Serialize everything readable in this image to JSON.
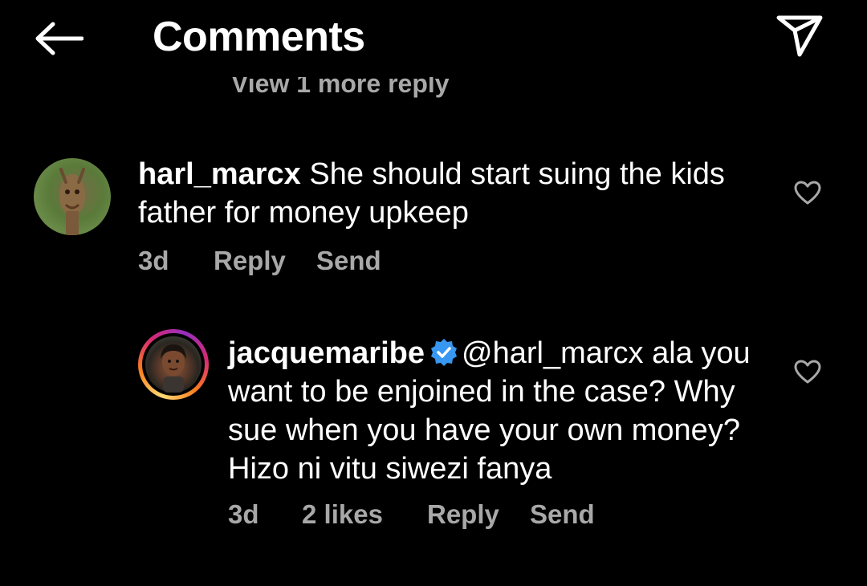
{
  "header": {
    "title": "Comments",
    "back_icon": "arrow-left-icon",
    "share_icon": "paper-plane-icon"
  },
  "view_more_replies": "View 1 more reply",
  "comments": [
    {
      "username": "harl_marcx",
      "text": "She should start suing the kids father for money upkeep",
      "time": "3d",
      "reply_label": "Reply",
      "send_label": "Send",
      "like_icon": "heart-outline-icon"
    },
    {
      "username": "jacquemaribe",
      "verified_icon": "verified-badge-icon",
      "mention": "@harl_marcx",
      "text": "ala you want to be enjoined in the case? Why sue when you have your own money? Hizo ni vitu siwezi fanya",
      "time": "3d",
      "likes": "2 likes",
      "reply_label": "Reply",
      "send_label": "Send",
      "like_icon": "heart-outline-icon"
    }
  ],
  "colors": {
    "background": "#000000",
    "text_primary": "#ffffff",
    "text_secondary": "#a8a8a8",
    "verified_blue": "#3897f0",
    "story_ring_start": "#feda75",
    "story_ring_end": "#d62976"
  }
}
